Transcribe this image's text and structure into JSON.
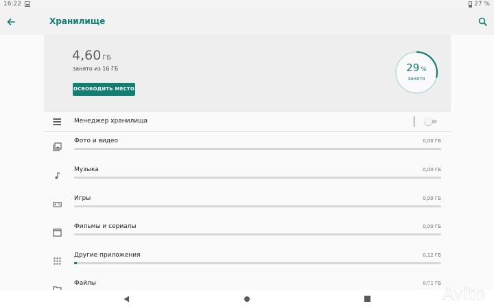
{
  "status_bar": {
    "time": "16:22",
    "battery": "27 %"
  },
  "app_bar": {
    "title": "Хранилище"
  },
  "summary": {
    "used_value": "4,60",
    "used_unit": "ГБ",
    "used_of_total": "занято из 16 ГБ",
    "free_up_label": "ОСВОБОДИТЬ МЕСТО",
    "percent_value": "29",
    "percent_unit": "%",
    "percent_caption": "занято",
    "usage_fraction": 0.29
  },
  "manager": {
    "label": "Менеджер хранилища",
    "enabled": false
  },
  "categories": [
    {
      "label": "Фото и видео",
      "size": "0,00 ГБ",
      "fraction": 0,
      "icon": "photo-video-icon"
    },
    {
      "label": "Музыка",
      "size": "0,00 ГБ",
      "fraction": 0,
      "icon": "music-note-icon"
    },
    {
      "label": "Игры",
      "size": "0,00 ГБ",
      "fraction": 0,
      "icon": "gamepad-icon"
    },
    {
      "label": "Фильмы и сериалы",
      "size": "0,00 ГБ",
      "fraction": 0,
      "icon": "movie-icon"
    },
    {
      "label": "Другие приложения",
      "size": "0,12 ГБ",
      "fraction": 0.0075,
      "icon": "apps-grid-icon"
    },
    {
      "label": "Файлы",
      "size": "0,00 ГБ",
      "fraction": 0,
      "icon": "folder-icon"
    }
  ],
  "watermark": {
    "text": "Avito"
  },
  "colors": {
    "accent": "#137e72",
    "title": "#0f7f73",
    "background": "#fafafa"
  }
}
